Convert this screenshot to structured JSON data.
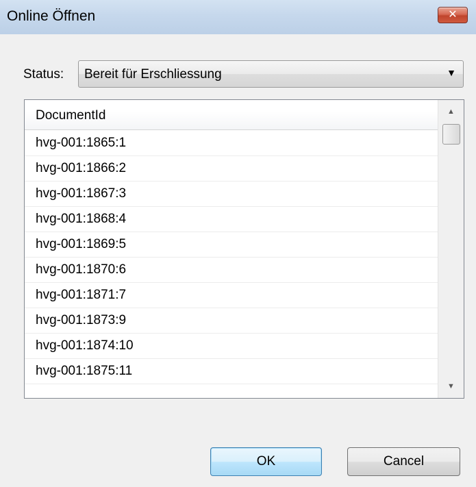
{
  "window": {
    "title": "Online Öffnen",
    "close_glyph": "✕"
  },
  "status": {
    "label": "Status:",
    "selected": "Bereit für Erschliessung",
    "arrow_glyph": "▼"
  },
  "list": {
    "header": "DocumentId",
    "rows": [
      "hvg-001:1865:1",
      "hvg-001:1866:2",
      "hvg-001:1867:3",
      "hvg-001:1868:4",
      "hvg-001:1869:5",
      "hvg-001:1870:6",
      "hvg-001:1871:7",
      "hvg-001:1873:9",
      "hvg-001:1874:10",
      "hvg-001:1875:11"
    ],
    "scroll_up_glyph": "▲",
    "scroll_down_glyph": "▼"
  },
  "buttons": {
    "ok": "OK",
    "cancel": "Cancel"
  },
  "colors": {
    "titlebar": "#c6d8ec",
    "close": "#c0452d",
    "ok_border": "#3c7fb1"
  }
}
